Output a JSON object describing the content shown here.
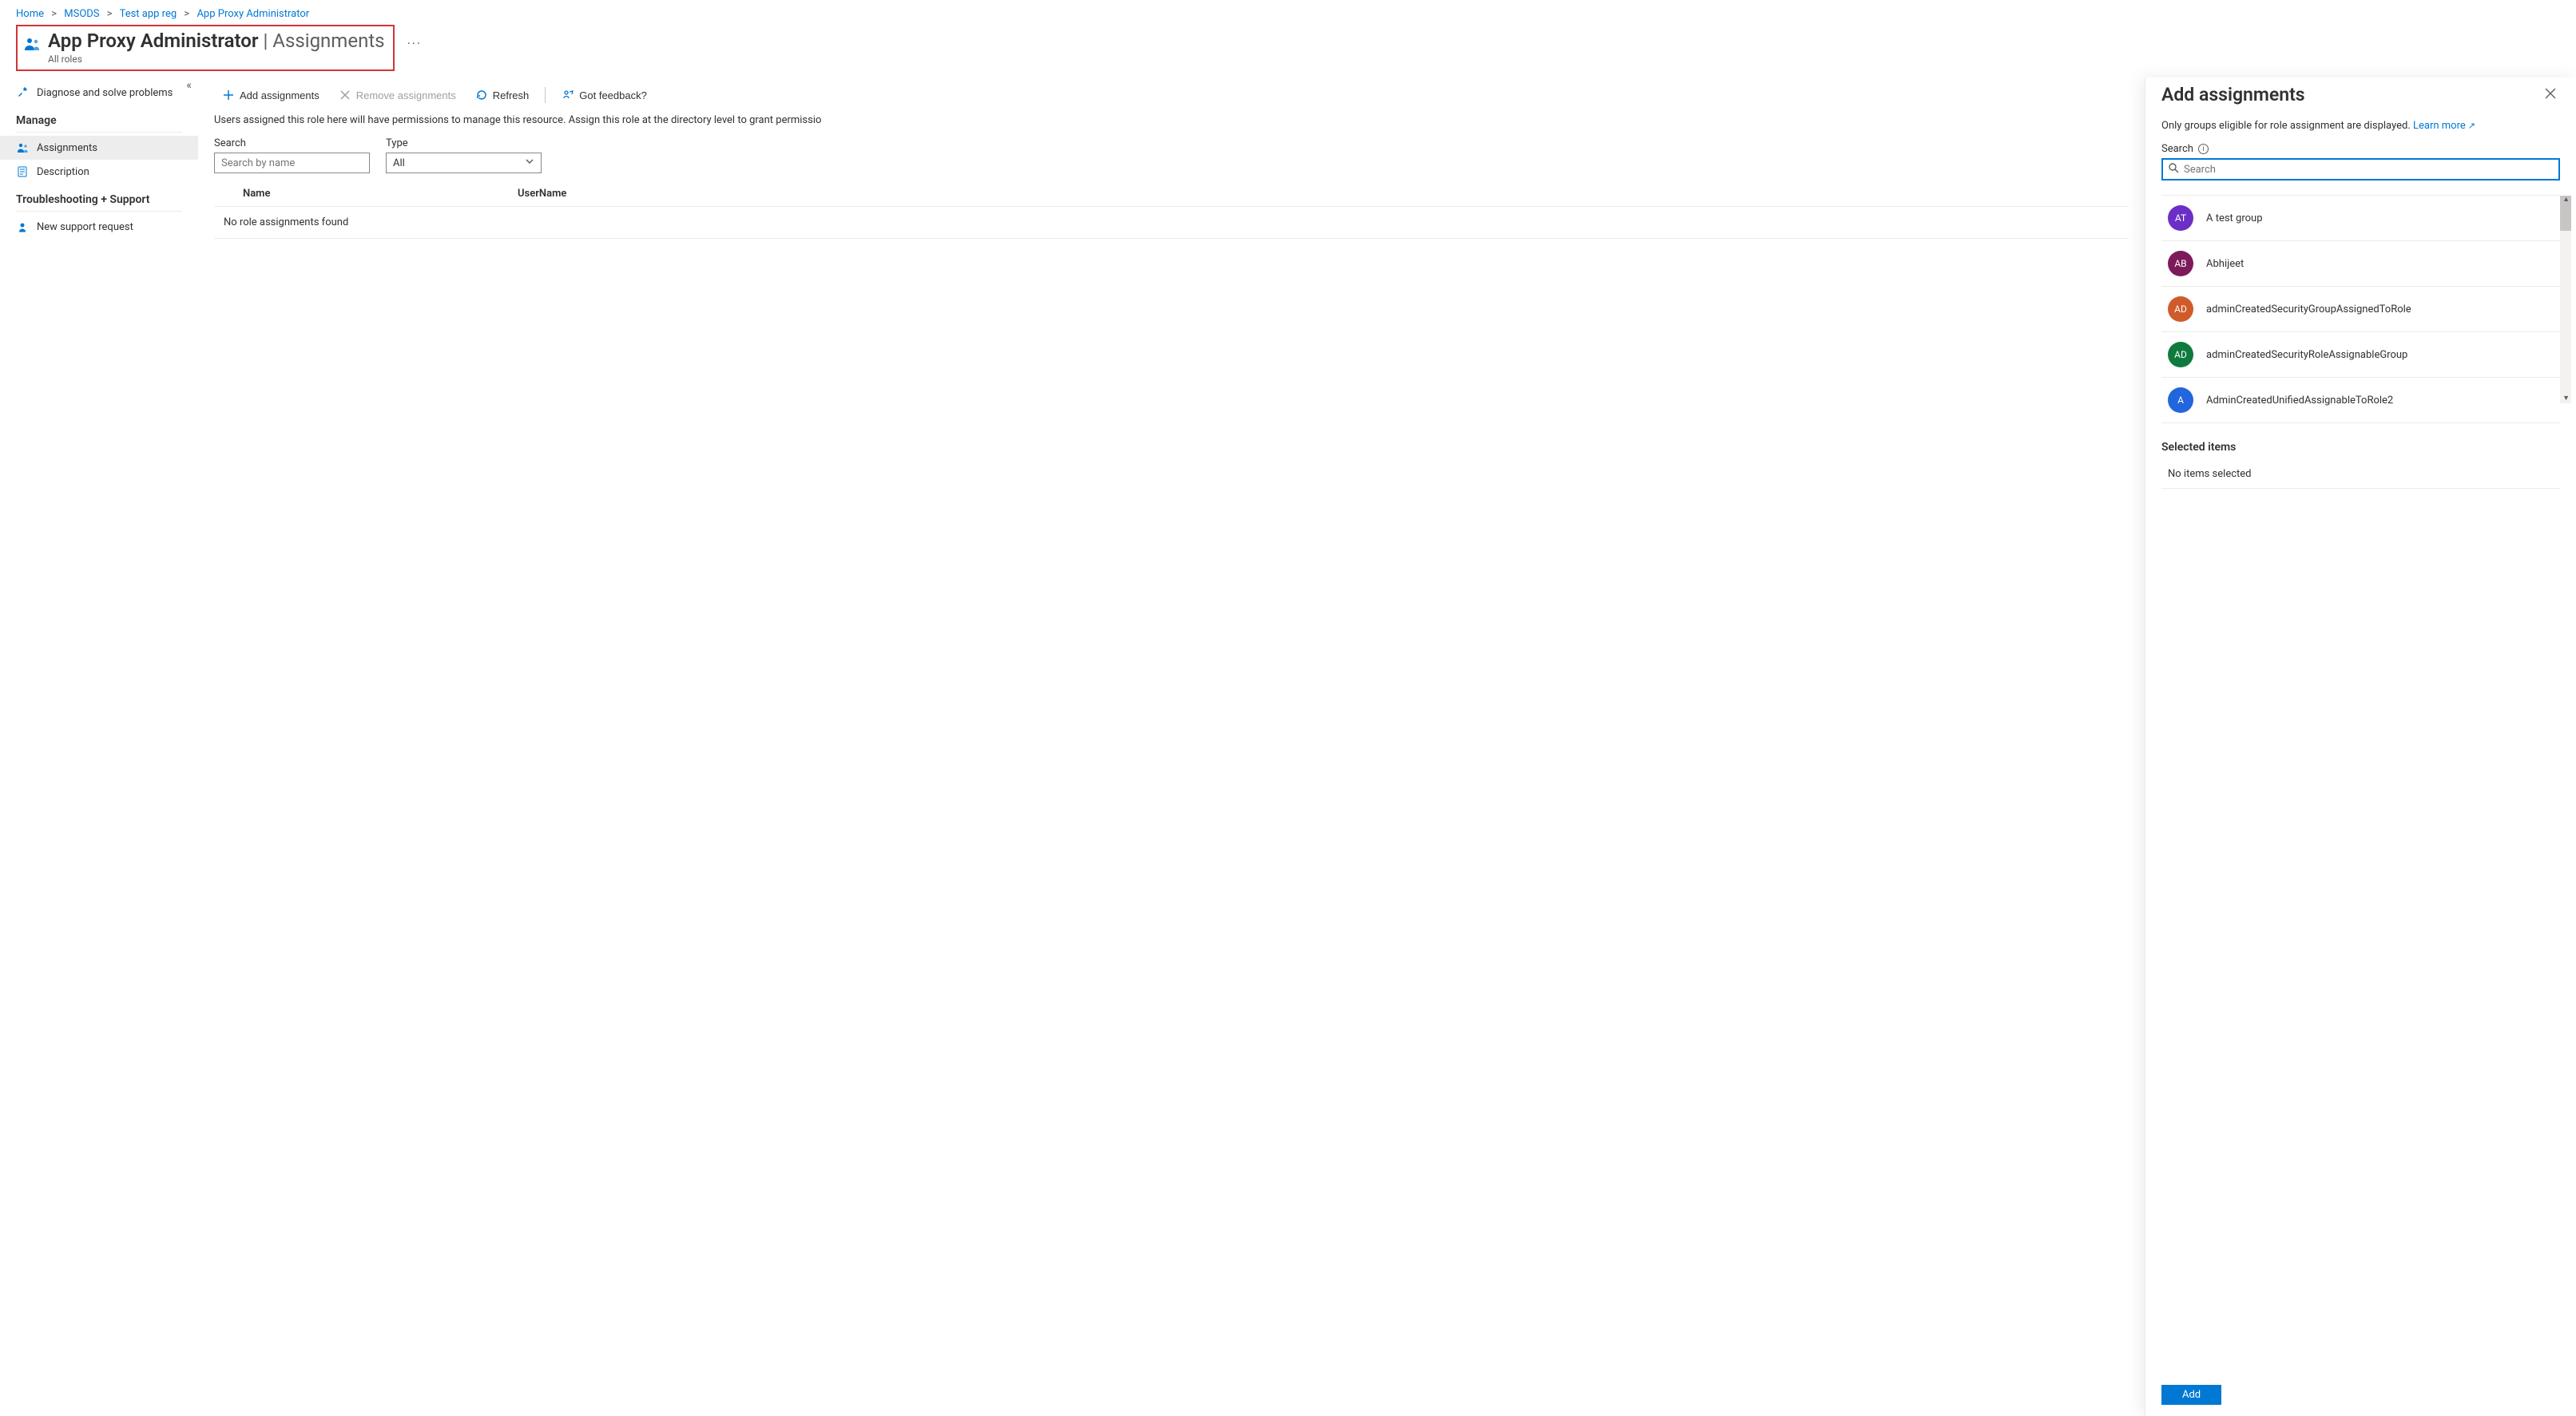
{
  "breadcrumb": {
    "items": [
      "Home",
      "MSODS",
      "Test app reg",
      "App Proxy Administrator"
    ]
  },
  "header": {
    "title_main": "App Proxy Administrator",
    "title_suffix": "Assignments",
    "subtitle": "All roles"
  },
  "sidebar": {
    "diagnose": "Diagnose and solve problems",
    "section_manage": "Manage",
    "assignments": "Assignments",
    "description": "Description",
    "section_troubleshoot": "Troubleshooting + Support",
    "new_support": "New support request"
  },
  "toolbar": {
    "add": "Add assignments",
    "remove": "Remove assignments",
    "refresh": "Refresh",
    "feedback": "Got feedback?"
  },
  "content": {
    "description": "Users assigned this role here will have permissions to manage this resource. Assign this role at the directory level to grant permissio",
    "search_label": "Search",
    "search_placeholder": "Search by name",
    "type_label": "Type",
    "type_value": "All",
    "col_name": "Name",
    "col_username": "UserName",
    "empty": "No role assignments found"
  },
  "panel": {
    "title": "Add assignments",
    "info_text": "Only groups eligible for role assignment are displayed.",
    "learn_more": "Learn more",
    "search_label": "Search",
    "search_placeholder": "Search",
    "results": [
      {
        "initials": "AT",
        "name": "A test group",
        "color": "#6b2fc7"
      },
      {
        "initials": "AB",
        "name": "Abhijeet",
        "color": "#7d1a5a"
      },
      {
        "initials": "AD",
        "name": "adminCreatedSecurityGroupAssignedToRole",
        "color": "#d05b2a"
      },
      {
        "initials": "AD",
        "name": "adminCreatedSecurityRoleAssignableGroup",
        "color": "#0f7a3d"
      },
      {
        "initials": "A",
        "name": "AdminCreatedUnifiedAssignableToRole2",
        "color": "#2266dd"
      }
    ],
    "selected_header": "Selected items",
    "no_selected": "No items selected",
    "add_button": "Add"
  }
}
